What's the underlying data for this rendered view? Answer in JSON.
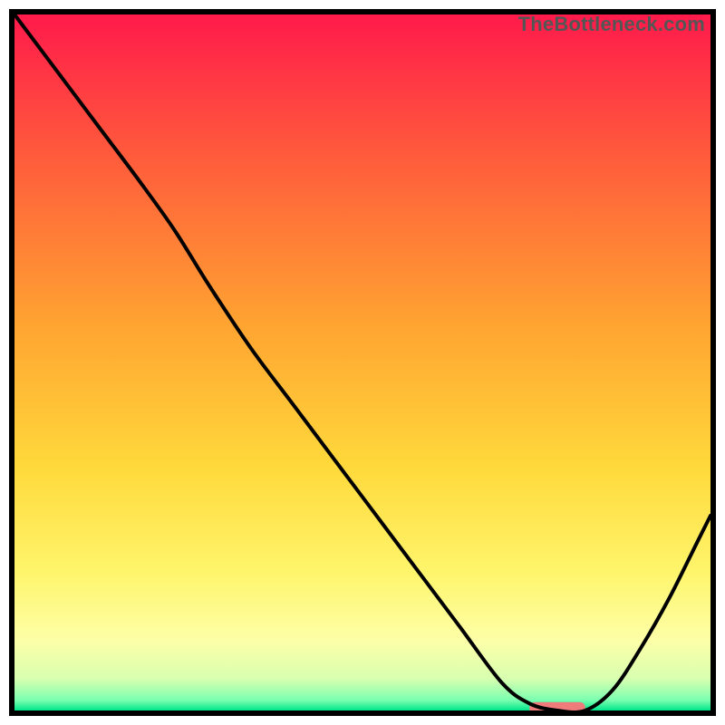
{
  "watermark": "TheBottleneck.com",
  "chart_data": {
    "type": "line",
    "title": "",
    "xlabel": "",
    "ylabel": "",
    "xlim": [
      0,
      100
    ],
    "ylim": [
      0,
      100
    ],
    "grid": false,
    "legend": false,
    "gradient_stops": [
      {
        "offset": 0.0,
        "color": "#ff1a4b"
      },
      {
        "offset": 0.2,
        "color": "#ff5a3c"
      },
      {
        "offset": 0.45,
        "color": "#ffa531"
      },
      {
        "offset": 0.65,
        "color": "#ffd93b"
      },
      {
        "offset": 0.8,
        "color": "#fff56b"
      },
      {
        "offset": 0.9,
        "color": "#fdffa8"
      },
      {
        "offset": 0.955,
        "color": "#d7ffb0"
      },
      {
        "offset": 0.985,
        "color": "#7bffb0"
      },
      {
        "offset": 1.0,
        "color": "#00e58a"
      }
    ],
    "series": [
      {
        "name": "bottleneck-curve",
        "x": [
          0,
          6,
          12,
          18,
          23,
          28,
          34,
          40,
          46,
          52,
          58,
          64,
          70,
          74,
          78,
          82,
          86,
          90,
          94,
          98,
          100
        ],
        "y": [
          100,
          92,
          84,
          76,
          69,
          61,
          52,
          44,
          36,
          28,
          20,
          12,
          4,
          1,
          0,
          0,
          3,
          9,
          16,
          24,
          28
        ]
      }
    ],
    "marker": {
      "name": "optimal-range",
      "x_start": 74,
      "x_end": 82,
      "y": 0.3,
      "color": "#ef7b7b"
    }
  }
}
